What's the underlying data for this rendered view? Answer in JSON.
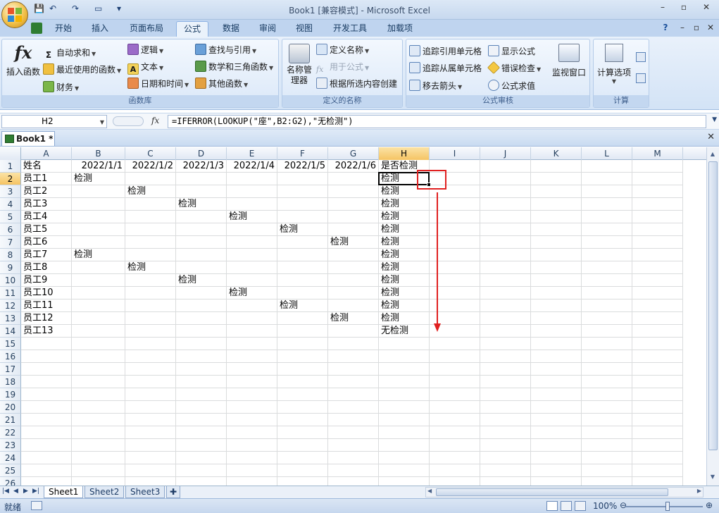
{
  "window": {
    "title": "Book1  [兼容模式] - Microsoft Excel",
    "controls": [
      "–",
      "▫",
      "✕"
    ],
    "ribbon_controls": [
      "?",
      "–",
      "▫",
      "✕"
    ]
  },
  "quick_access": {
    "save": "💾",
    "undo": "↶",
    "redo": "↷",
    "print": "▾"
  },
  "tabs": [
    "开始",
    "插入",
    "页面布局",
    "公式",
    "数据",
    "审阅",
    "视图",
    "开发工具",
    "加载项"
  ],
  "active_tab": "公式",
  "ribbon": {
    "function_library": {
      "label": "函数库",
      "insert_function": "插入函数",
      "fx_symbol": "fx",
      "autosum": "自动求和",
      "recent": "最近使用的函数",
      "financial": "财务",
      "logical": "逻辑",
      "text": "文本",
      "datetime": "日期和时间",
      "lookup": "查找与引用",
      "math": "数学和三角函数",
      "other": "其他函数"
    },
    "defined_names": {
      "label": "定义的名称",
      "name_manager": "名称管理器",
      "define_name": "定义名称",
      "use_in_formula": "用于公式",
      "create_from_selection": "根据所选内容创建"
    },
    "formula_auditing": {
      "label": "公式审核",
      "trace_precedents": "追踪引用单元格",
      "trace_dependents": "追踪从属单元格",
      "remove_arrows": "移去箭头",
      "show_formulas": "显示公式",
      "error_checking": "错误检查",
      "evaluate_formula": "公式求值",
      "watch_window": "监视窗口"
    },
    "calculation": {
      "label": "计算",
      "calc_options": "计算选项"
    }
  },
  "formula_bar": {
    "name_box": "H2",
    "fx": "fx",
    "formula": "=IFERROR(LOOKUP(\"座\",B2:G2),\"无检测\")"
  },
  "workbook_tab": "Book1 *",
  "columns": [
    "A",
    "B",
    "C",
    "D",
    "E",
    "F",
    "G",
    "H",
    "I",
    "J",
    "K",
    "L",
    "M"
  ],
  "selected_column": "H",
  "selected_row": "2",
  "rows": [
    {
      "n": "1",
      "cells": [
        "姓名",
        "2022/1/1",
        "2022/1/2",
        "2022/1/3",
        "2022/1/4",
        "2022/1/5",
        "2022/1/6",
        "是否检测"
      ]
    },
    {
      "n": "2",
      "cells": [
        "员工1",
        "检测",
        "",
        "",
        "",
        "",
        "",
        "检测"
      ]
    },
    {
      "n": "3",
      "cells": [
        "员工2",
        "",
        "检测",
        "",
        "",
        "",
        "",
        "检测"
      ]
    },
    {
      "n": "4",
      "cells": [
        "员工3",
        "",
        "",
        "检测",
        "",
        "",
        "",
        "检测"
      ]
    },
    {
      "n": "5",
      "cells": [
        "员工4",
        "",
        "",
        "",
        "检测",
        "",
        "",
        "检测"
      ]
    },
    {
      "n": "6",
      "cells": [
        "员工5",
        "",
        "",
        "",
        "",
        "检测",
        "",
        "检测"
      ]
    },
    {
      "n": "7",
      "cells": [
        "员工6",
        "",
        "",
        "",
        "",
        "",
        "检测",
        "检测"
      ]
    },
    {
      "n": "8",
      "cells": [
        "员工7",
        "检测",
        "",
        "",
        "",
        "",
        "",
        "检测"
      ]
    },
    {
      "n": "9",
      "cells": [
        "员工8",
        "",
        "检测",
        "",
        "",
        "",
        "",
        "检测"
      ]
    },
    {
      "n": "10",
      "cells": [
        "员工9",
        "",
        "",
        "检测",
        "",
        "",
        "",
        "检测"
      ]
    },
    {
      "n": "11",
      "cells": [
        "员工10",
        "",
        "",
        "",
        "检测",
        "",
        "",
        "检测"
      ]
    },
    {
      "n": "12",
      "cells": [
        "员工11",
        "",
        "",
        "",
        "",
        "检测",
        "",
        "检测"
      ]
    },
    {
      "n": "13",
      "cells": [
        "员工12",
        "",
        "",
        "",
        "",
        "",
        "检测",
        "检测"
      ]
    },
    {
      "n": "14",
      "cells": [
        "员工13",
        "",
        "",
        "",
        "",
        "",
        "",
        "无检测"
      ]
    },
    {
      "n": "15",
      "cells": []
    },
    {
      "n": "16",
      "cells": []
    },
    {
      "n": "17",
      "cells": []
    },
    {
      "n": "18",
      "cells": []
    },
    {
      "n": "19",
      "cells": []
    },
    {
      "n": "20",
      "cells": []
    },
    {
      "n": "21",
      "cells": []
    },
    {
      "n": "22",
      "cells": []
    },
    {
      "n": "23",
      "cells": []
    },
    {
      "n": "24",
      "cells": []
    },
    {
      "n": "25",
      "cells": []
    },
    {
      "n": "26",
      "cells": []
    }
  ],
  "sheet_tabs": [
    "Sheet1",
    "Sheet2",
    "Sheet3"
  ],
  "active_sheet": "Sheet1",
  "status": {
    "ready": "就绪",
    "zoom": "100%"
  },
  "colors": {
    "annotation_red": "#e02020",
    "ribbon_blue": "#d3e3f6",
    "selection_header": "#f5c463"
  }
}
